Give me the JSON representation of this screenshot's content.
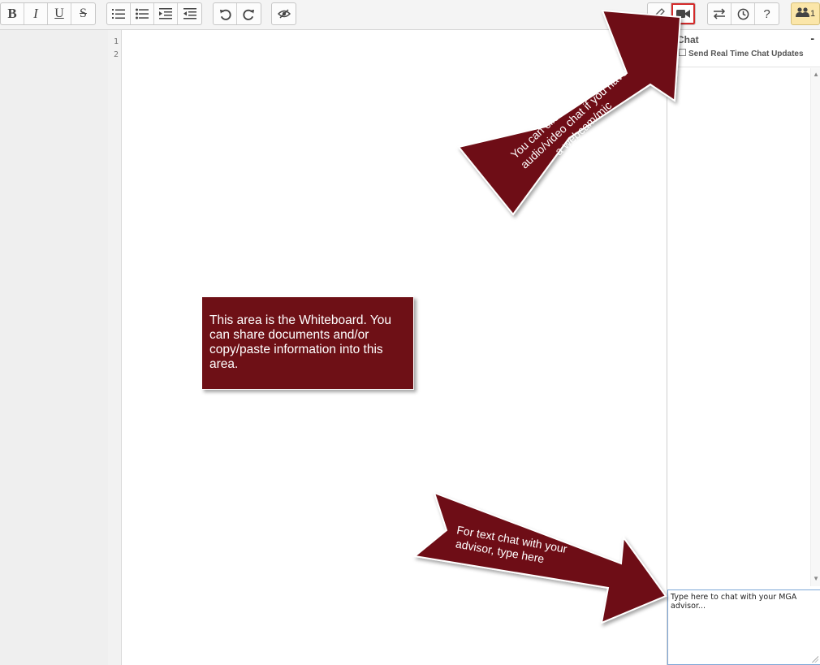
{
  "toolbar": {
    "format": [
      {
        "name": "bold-button",
        "glyph": "B"
      },
      {
        "name": "italic-button",
        "glyph": "I"
      },
      {
        "name": "underline-button",
        "glyph": "U"
      },
      {
        "name": "strikethrough-button",
        "glyph": "S"
      }
    ],
    "icons": [
      "ordered-list-icon",
      "bullet-list-icon",
      "indent-icon",
      "outdent-icon",
      "undo-icon",
      "redo-icon",
      "hide-icon",
      "pencil-icon",
      "video-camera-icon",
      "swap-icon",
      "clock-icon",
      "help-icon",
      "users-icon"
    ],
    "help_glyph": "?",
    "user_count": "1"
  },
  "editor": {
    "line_numbers": [
      "1",
      "2"
    ]
  },
  "chat": {
    "title": "Chat",
    "minimize_glyph": "-",
    "realtime_label": "Send Real Time Chat Updates",
    "input_value": "Type here to chat with your MGA advisor..."
  },
  "annotations": {
    "whiteboard_note": "This area is the Whiteboard.  You can share documents and/or copy/paste information into this area.",
    "video_arrow_lines": [
      "You can click here to enable",
      "audio/video chat if you have",
      "a webcam/mic"
    ],
    "text_arrow_lines": [
      "For text chat with your",
      "advisor, type here"
    ]
  },
  "colors": {
    "annotation_fill": "#6e1016",
    "highlight_border": "#d42a2a",
    "users_badge": "#fbe6a9"
  }
}
